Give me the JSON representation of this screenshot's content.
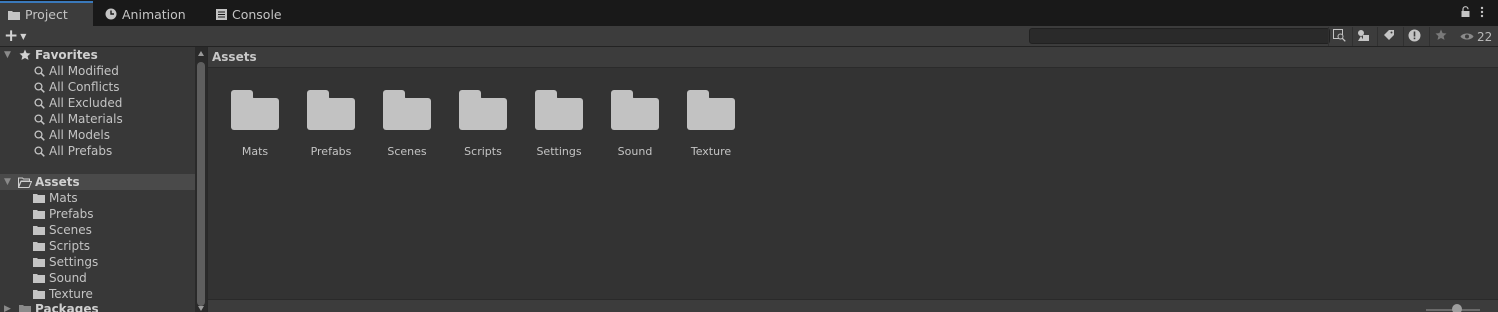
{
  "tabs": [
    {
      "label": "Project",
      "icon": "folder-icon"
    },
    {
      "label": "Animation",
      "icon": "clock-icon"
    },
    {
      "label": "Console",
      "icon": "console-icon"
    }
  ],
  "toolbar": {
    "create_icon": "+",
    "search_value": "",
    "visibility_count": "22"
  },
  "sidebar": {
    "favorites_label": "Favorites",
    "favorites": [
      "All Modified",
      "All Conflicts",
      "All Excluded",
      "All Materials",
      "All Models",
      "All Prefabs"
    ],
    "assets_label": "Assets",
    "assets": [
      "Mats",
      "Prefabs",
      "Scenes",
      "Scripts",
      "Settings",
      "Sound",
      "Texture"
    ],
    "packages_label": "Packages"
  },
  "main": {
    "breadcrumb": "Assets",
    "folders": [
      "Mats",
      "Prefabs",
      "Scenes",
      "Scripts",
      "Settings",
      "Sound",
      "Texture"
    ]
  },
  "colors": {
    "accent": "#3a79bb",
    "background": "#333333",
    "folder": "#c2c2c2"
  }
}
